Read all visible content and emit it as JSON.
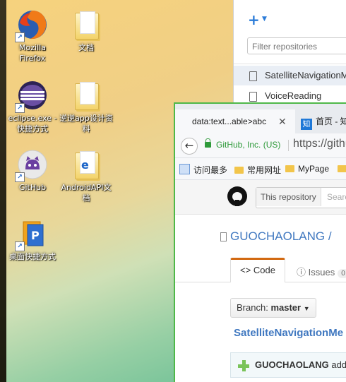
{
  "desktop": {
    "icons": [
      {
        "label": "Mozilla Firefox",
        "icon": "firefox-icon"
      },
      {
        "label": "文档",
        "icon": "folder-icon"
      },
      {
        "label": "eclipse.exe - 快捷方式",
        "icon": "eclipse-icon"
      },
      {
        "label": "逆逆app设计资料",
        "icon": "folder-icon"
      },
      {
        "label": "GitHub",
        "icon": "github-icon"
      },
      {
        "label": "AndroidAPI文档",
        "icon": "folder-ie-icon"
      },
      {
        "label": "桌面快捷方式",
        "icon": "shortcut-app-icon"
      }
    ]
  },
  "github_desktop": {
    "add_label": "+",
    "filter_placeholder": "Filter repositories",
    "repos": [
      "SatelliteNavigationMe",
      "VoiceReading"
    ]
  },
  "browser": {
    "tabs": [
      {
        "title": "data:text...able>abc"
      },
      {
        "title": "首页 - 知"
      }
    ],
    "zhihu_icon_text": "知",
    "ev_label": "GitHub, Inc. (US)",
    "url": "https://github",
    "bookmarks": [
      "访问最多",
      "常用网址",
      "MyPage"
    ],
    "github": {
      "search_scope": "This repository",
      "search_placeholder": "Search",
      "repo_owner": "GUOCHAOLANG /",
      "tab_code": "Code",
      "tab_issues": "Issues",
      "issues_count": "0",
      "branch_label": "Branch:",
      "branch_name": "master",
      "breadcrumb": "SatelliteNavigationMe",
      "commit_author": "GUOCHAOLANG",
      "commit_suffix": "add"
    }
  },
  "colors": {
    "browser_border": "#4fb849",
    "link_blue": "#4078c0",
    "code_tab_accent": "#d26911"
  }
}
